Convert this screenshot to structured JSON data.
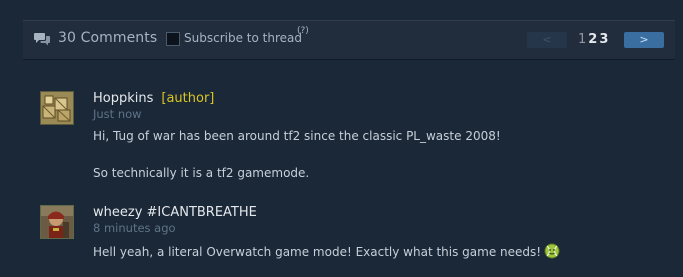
{
  "header": {
    "comment_count": "30 Comments",
    "subscribe_label": "Subscribe to thread",
    "help_label": "(?)",
    "prev_label": "<",
    "next_label": ">",
    "pages": [
      "1",
      "2",
      "3"
    ],
    "current_page": "1"
  },
  "comments": [
    {
      "author": "Hoppkins",
      "author_tag": "[author]",
      "timestamp": "Just now",
      "lines": [
        "Hi, Tug of war has been around tf2 since the classic PL_waste 2008!",
        "So technically it is a tf2 gamemode."
      ],
      "avatar_icon": "wooden-crates-avatar-icon"
    },
    {
      "author": "wheezy #ICANTBREATHE",
      "timestamp": "8 minutes ago",
      "lines": [
        "Hell yeah, a literal Overwatch game mode! Exactly what this game needs!"
      ],
      "emoticon": "tennis-ball-emoticon-icon",
      "avatar_icon": "character-portrait-avatar-icon"
    }
  ],
  "colors": {
    "background": "#1b2838",
    "header_bg": "#212c3d",
    "author_tag": "#d9c51f",
    "next_button": "#3a6ea1"
  }
}
